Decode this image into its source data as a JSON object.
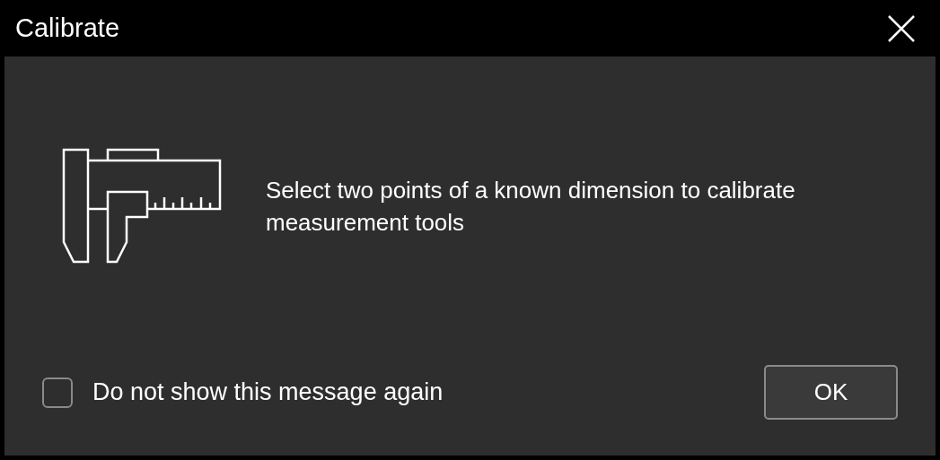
{
  "window": {
    "title": "Calibrate"
  },
  "message": "Select two points of a known dimension to calibrate measurement tools",
  "checkbox": {
    "label": "Do not show this message again",
    "checked": false
  },
  "buttons": [
    "OK"
  ]
}
